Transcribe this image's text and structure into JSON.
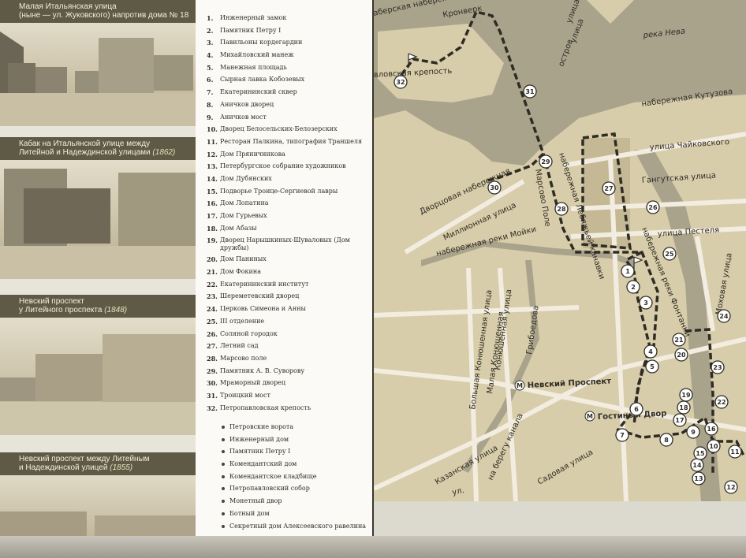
{
  "photos": [
    {
      "line1": "Малая Итальянская улица",
      "line2": "(ныне — ул. Жуковского) напротив дома № 18",
      "year": ""
    },
    {
      "line1": "Кабак на Итальянской улице между",
      "line2": "Литейной и Надеждинской улицами",
      "year": "(1862)"
    },
    {
      "line1": "Невский проспект",
      "line2": "у Литейного проспекта",
      "year": "(1848)"
    },
    {
      "line1": "Невский проспект между Литейным",
      "line2": "и Надеждинской улицей",
      "year": "(1855)"
    }
  ],
  "places": [
    {
      "num": "1.",
      "name": "Инженерный замок"
    },
    {
      "num": "2.",
      "name": "Памятник Петру I"
    },
    {
      "num": "3.",
      "name": "Павильоны кордегардии"
    },
    {
      "num": "4.",
      "name": "Михайловский манеж"
    },
    {
      "num": "5.",
      "name": "Манежная площадь"
    },
    {
      "num": "6.",
      "name": "Сырная лавка Кобозевых"
    },
    {
      "num": "7.",
      "name": "Екатерининский сквер"
    },
    {
      "num": "8.",
      "name": "Аничков дворец"
    },
    {
      "num": "9.",
      "name": "Аничков мост"
    },
    {
      "num": "10.",
      "name": "Дворец Белосельских-Белозерских"
    },
    {
      "num": "11.",
      "name": "Ресторан Палкина, типография Траншеля"
    },
    {
      "num": "12.",
      "name": "Дом Пряничникова"
    },
    {
      "num": "13.",
      "name": "Петербургское собрание художников"
    },
    {
      "num": "14.",
      "name": "Дом Дубянских"
    },
    {
      "num": "15.",
      "name": "Подворье Троице-Сергиевой лавры"
    },
    {
      "num": "16.",
      "name": "Дом Лопатина"
    },
    {
      "num": "17.",
      "name": "Дом Гурьевых"
    },
    {
      "num": "18.",
      "name": "Дом Абазы"
    },
    {
      "num": "19.",
      "name": "Дворец Нарышкиных-Шуваловых (Дом дружбы)"
    },
    {
      "num": "20.",
      "name": "Дом Паниных"
    },
    {
      "num": "21.",
      "name": "Дом Фокина"
    },
    {
      "num": "22.",
      "name": "Екатерининский институт"
    },
    {
      "num": "23.",
      "name": "Шереметевский дворец"
    },
    {
      "num": "24.",
      "name": "Церковь Симеона и Анны"
    },
    {
      "num": "25.",
      "name": "III отделение"
    },
    {
      "num": "26.",
      "name": "Соляной городок"
    },
    {
      "num": "27.",
      "name": "Летний сад"
    },
    {
      "num": "28.",
      "name": "Марсово поле"
    },
    {
      "num": "29.",
      "name": "Памятник А. В. Суворову"
    },
    {
      "num": "30.",
      "name": "Мраморный дворец"
    },
    {
      "num": "31.",
      "name": "Троицкий мост"
    },
    {
      "num": "32.",
      "name": "Петропавловская крепость"
    }
  ],
  "fortress_items": [
    "Петровские ворота",
    "Инженерный дом",
    "Памятник Петру I",
    "Комендантский дом",
    "Комендантское кладбище",
    "Петропавловский собор",
    "Монетный двор",
    "Ботный дом",
    "Секретный дом Алексеевского равелина"
  ],
  "map": {
    "streets": {
      "naberezhnaya_top": "аберская набережная",
      "kronverk": "Кронверк",
      "ulitsa_top": "улица",
      "reka_neva": "река Нева",
      "krepost": "вловская крепость",
      "kutuzova": "набережная Кутузова",
      "chaikovskogo": "улица Чайковского",
      "dvortsovaya": "Дворцовая набережная",
      "lebyazhya": "набережная Лебяжьей канавки",
      "millionnaya": "Миллионная улица",
      "marsovo_pole": "Марсово Поле",
      "gangutskaya": "Гангутская улица",
      "pestelya": "улица Пестеля",
      "moyki": "набережная реки Мойки",
      "fontanki": "набережная реки Фонтанки",
      "mokhovaya": "Моховая улица",
      "konyushennaya": "Конюшенная улица",
      "malaya_konyushennaya": "Малая Конюшенная",
      "bolshaya_konyushennaya": "Большая Конюшенная улица",
      "griboedova": "Грибоедова",
      "na_beregu_kanala": "на берегу канала",
      "kazanskaya": "Казанская улица",
      "sadovaya": "Садовая улица",
      "italyanskaya": "ул.",
      "ostrov": "остров",
      "ulitsa_mid": "улица"
    },
    "metro": {
      "nevsky": "Невский Проспект",
      "gostiny": "Гостиный Двор"
    },
    "colors": {
      "water": "#aaa38c",
      "ground": "#d8cdaa",
      "roads": "#f2ede0",
      "route": "#2f2c25"
    },
    "markers": [
      "1",
      "2",
      "3",
      "4",
      "5",
      "6",
      "7",
      "8",
      "9",
      "10",
      "11",
      "12",
      "13",
      "14",
      "15",
      "16",
      "17",
      "18",
      "19",
      "20",
      "21",
      "22",
      "23",
      "24",
      "25",
      "26",
      "27",
      "28",
      "29",
      "30",
      "31",
      "32"
    ]
  }
}
